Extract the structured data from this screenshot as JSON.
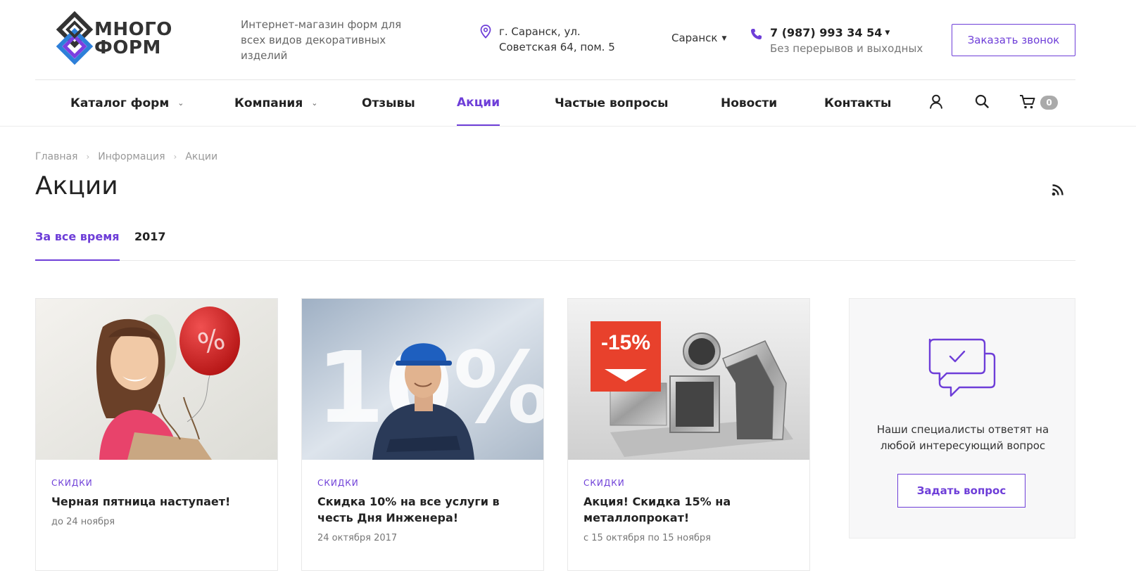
{
  "header": {
    "logo_line1": "МНОГО",
    "logo_line2": "ФОРМ",
    "tagline": "Интернет-магазин форм для всех видов декоративных изделий",
    "address_line1": "г. Саранск, ул.",
    "address_line2": "Советская 64, пом. 5",
    "city": "Саранск",
    "phone": "7 (987) 993 34 54",
    "phone_note": "Без перерывов и выходных",
    "callback_label": "Заказать звонок"
  },
  "nav": {
    "items": [
      {
        "label": "Каталог форм",
        "has_dropdown": true
      },
      {
        "label": "Компания",
        "has_dropdown": true
      },
      {
        "label": "Отзывы"
      },
      {
        "label": "Акции",
        "active": true
      },
      {
        "label": "Частые вопросы"
      },
      {
        "label": "Новости"
      },
      {
        "label": "Контакты"
      }
    ],
    "cart_count": "0",
    "icons": [
      "user-icon",
      "search-icon",
      "cart-icon"
    ]
  },
  "breadcrumb": [
    "Главная",
    "Информация",
    "Акции"
  ],
  "page_title": "Акции",
  "tabs": [
    {
      "label": "За все время",
      "active": true
    },
    {
      "label": "2017"
    }
  ],
  "cards": [
    {
      "tag": "скидки",
      "title": "Черная пятница наступает!",
      "date": "до 24 ноября",
      "image": "woman-balloon-percent"
    },
    {
      "tag": "скидки",
      "title": "Скидка 10% на все услуги в честь Дня Инженера!",
      "date": "24 октября 2017",
      "image": "engineer-10-percent"
    },
    {
      "tag": "скидки",
      "title": "Акция! Скидка 15% на металлопрокат!",
      "date": "с 15 октября по 15 ноября",
      "image": "metal-profiles-15-percent",
      "badge": "-15%"
    }
  ],
  "question_box": {
    "text": "Наши специалисты ответят на любой интересующий вопрос",
    "button_label": "Задать вопрос"
  },
  "colors": {
    "accent": "#6e3ed8",
    "text": "#222222",
    "muted": "#777777"
  }
}
